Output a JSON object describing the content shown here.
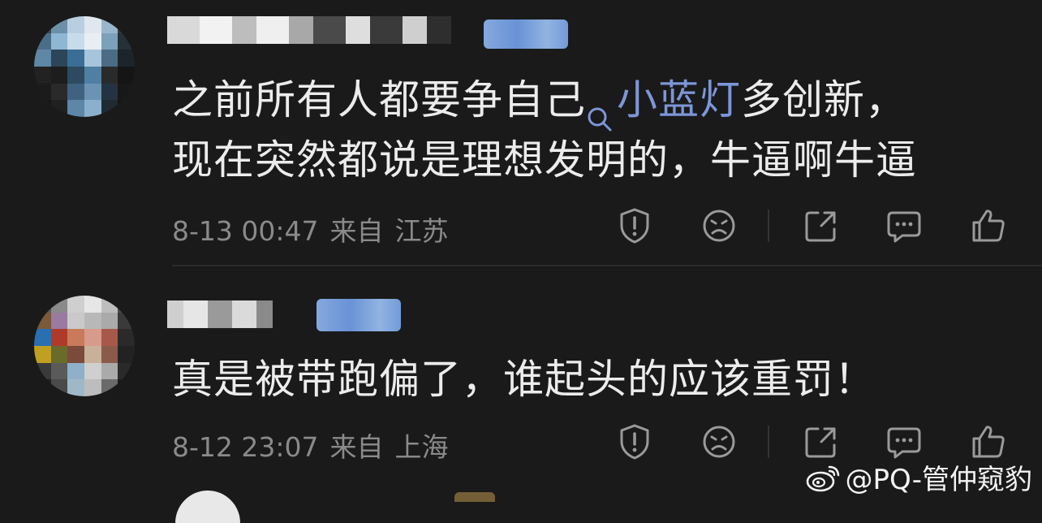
{
  "comments": [
    {
      "text_before": "之前所有人都要争自己",
      "topic": "小蓝灯",
      "text_after_line1": "多创新，",
      "line2": "现在突然都说是理想发明的，牛逼啊牛逼",
      "date": "8-13 00:47",
      "source_label": "来自",
      "location": "江苏"
    },
    {
      "text": "真是被带跑偏了，谁起头的应该重罚！",
      "date": "8-12 23:07",
      "source_label": "来自",
      "location": "上海"
    }
  ],
  "icons": [
    "report-icon",
    "dislike-face-icon",
    "share-icon",
    "comment-icon",
    "like-thumb-icon"
  ],
  "watermark": {
    "text": "@PQ-管仲窥豹",
    "logo": "weibo-logo-icon"
  },
  "colors": {
    "background": "#1a1a1a",
    "text": "#ececec",
    "meta": "#8a8a8a",
    "topic_link": "#7d96d8",
    "icon": "#9a9a9a"
  }
}
